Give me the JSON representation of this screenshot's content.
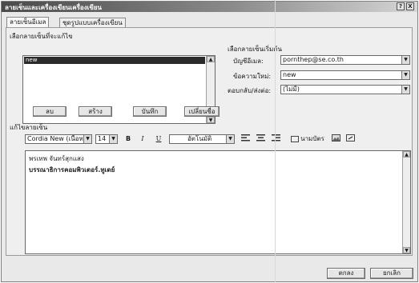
{
  "window": {
    "title": "ลายเซ็นและเครื่องเขียนเครื่องเขียน",
    "close_label": "X",
    "help_label": "?"
  },
  "tabs": [
    {
      "label": "ลายเซ็นอีเมล",
      "active": true
    },
    {
      "label": "ชุดรูปแบบเครื่องเขียน",
      "active": false
    }
  ],
  "select_signature": {
    "label": "เลือกลายเซ็นที่จะแก้ไข",
    "items": [
      {
        "label": "new",
        "selected": true
      }
    ]
  },
  "signature_buttons": {
    "delete": "ลบ",
    "new": "สร้าง",
    "save": "บันทึก",
    "rename": "เปลี่ยนชื่อ"
  },
  "default_signature": {
    "label": "เลือกลายเซ็นเริ่มต้น",
    "account_label": "บัญชีอีเมล:",
    "account_value": "pornthep@se.co.th",
    "new_messages_label": "ข้อความใหม่:",
    "new_messages_value": "new",
    "replies_label": "ตอบกลับ/ส่งต่อ:",
    "replies_value": "(ไม่มี)"
  },
  "edit_signature": {
    "label": "แก้ไขลายเซ็น",
    "font_value": "Cordia New (เนื้อหา)",
    "size_value": "14",
    "bold_label": "B",
    "italic_label": "I",
    "underline_label": "U",
    "color_value": "อัตโนมัติ",
    "business_card_label": "นามบัตร",
    "body_line1": "พรเทพ จันทร์สุกแสง",
    "body_line2": "บรรณาธิการคอมพิวเตอร์.ทูเดย์"
  },
  "footer": {
    "ok_label": "ตกลง",
    "cancel_label": "ยกเลิก"
  }
}
